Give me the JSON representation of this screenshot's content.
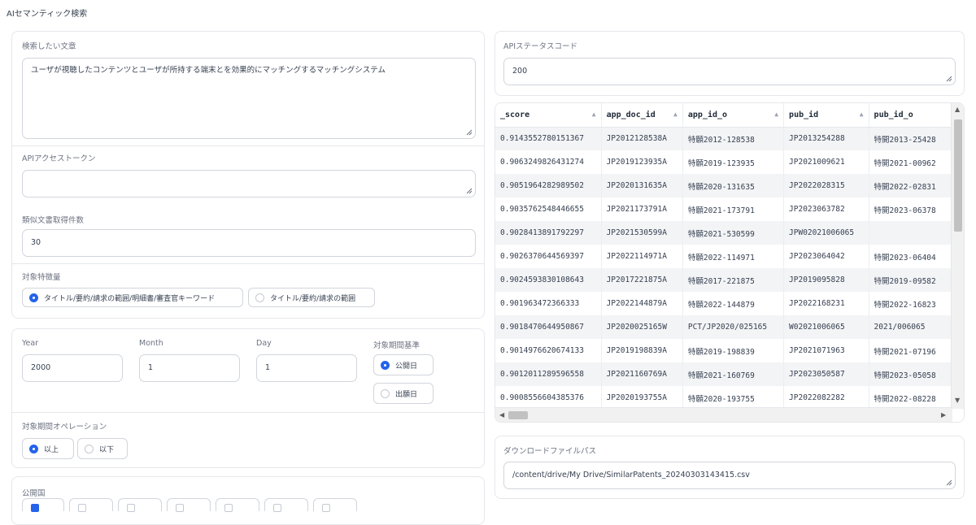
{
  "app_title": "AIセマンティック検索",
  "left": {
    "query_label": "検索したい文章",
    "query_value": "ユーザが視聴したコンテンツとユーザが所持する端末とを効果的にマッチングするマッチングシステム",
    "token_label": "APIアクセストークン",
    "token_value": "",
    "count_label": "類似文書取得件数",
    "count_value": "30",
    "feature_label": "対象特徴量",
    "feature_options": [
      {
        "label": "タイトル/要約/請求の範囲/明細書/審査官キーワード",
        "selected": true
      },
      {
        "label": "タイトル/要約/請求の範囲",
        "selected": false
      }
    ],
    "year_label": "Year",
    "year_value": "2000",
    "month_label": "Month",
    "month_value": "1",
    "day_label": "Day",
    "day_value": "1",
    "period_basis_label": "対象期間基準",
    "period_basis_options": [
      {
        "label": "公開日",
        "selected": true
      },
      {
        "label": "出願日",
        "selected": false
      }
    ],
    "period_op_label": "対象期間オペレーション",
    "period_op_options": [
      {
        "label": "以上",
        "selected": true
      },
      {
        "label": "以下",
        "selected": false
      }
    ],
    "country_label": "公開国"
  },
  "right": {
    "status_label": "APIステータスコード",
    "status_value": "200",
    "table": {
      "columns": [
        "_score",
        "app_doc_id",
        "app_id_o",
        "pub_id",
        "pub_id_o"
      ],
      "rows": [
        [
          "0.9143552780151367",
          "JP2012128538A",
          "特願2012-128538",
          "JP2013254288",
          "特開2013-25428"
        ],
        [
          "0.9063249826431274",
          "JP2019123935A",
          "特願2019-123935",
          "JP2021009621",
          "特開2021-00962"
        ],
        [
          "0.9051964282989502",
          "JP2020131635A",
          "特願2020-131635",
          "JP2022028315",
          "特開2022-02831"
        ],
        [
          "0.9035762548446655",
          "JP2021173791A",
          "特願2021-173791",
          "JP2023063782",
          "特開2023-06378"
        ],
        [
          "0.9028413891792297",
          "JP2021530599A",
          "特願2021-530599",
          "JPW02021006065",
          ""
        ],
        [
          "0.9026370644569397",
          "JP2022114971A",
          "特願2022-114971",
          "JP2023064042",
          "特開2023-06404"
        ],
        [
          "0.9024593830108643",
          "JP2017221875A",
          "特願2017-221875",
          "JP2019095828",
          "特開2019-09582"
        ],
        [
          "0.901963472366333",
          "JP2022144879A",
          "特願2022-144879",
          "JP2022168231",
          "特開2022-16823"
        ],
        [
          "0.9018470644950867",
          "JP2020025165W",
          "PCT/JP2020/025165",
          "W02021006065",
          "2021/006065"
        ],
        [
          "0.9014976620674133",
          "JP2019198839A",
          "特願2019-198839",
          "JP2021071963",
          "特開2021-07196"
        ],
        [
          "0.9012011289596558",
          "JP2021160769A",
          "特願2021-160769",
          "JP2023050587",
          "特開2023-05058"
        ],
        [
          "0.9008556604385376",
          "JP2020193755A",
          "特願2020-193755",
          "JP2022082282",
          "特開2022-08228"
        ]
      ]
    },
    "download_label": "ダウンロードファイルパス",
    "download_value": "/content/drive/My Drive/SimilarPatents_20240303143415.csv"
  }
}
